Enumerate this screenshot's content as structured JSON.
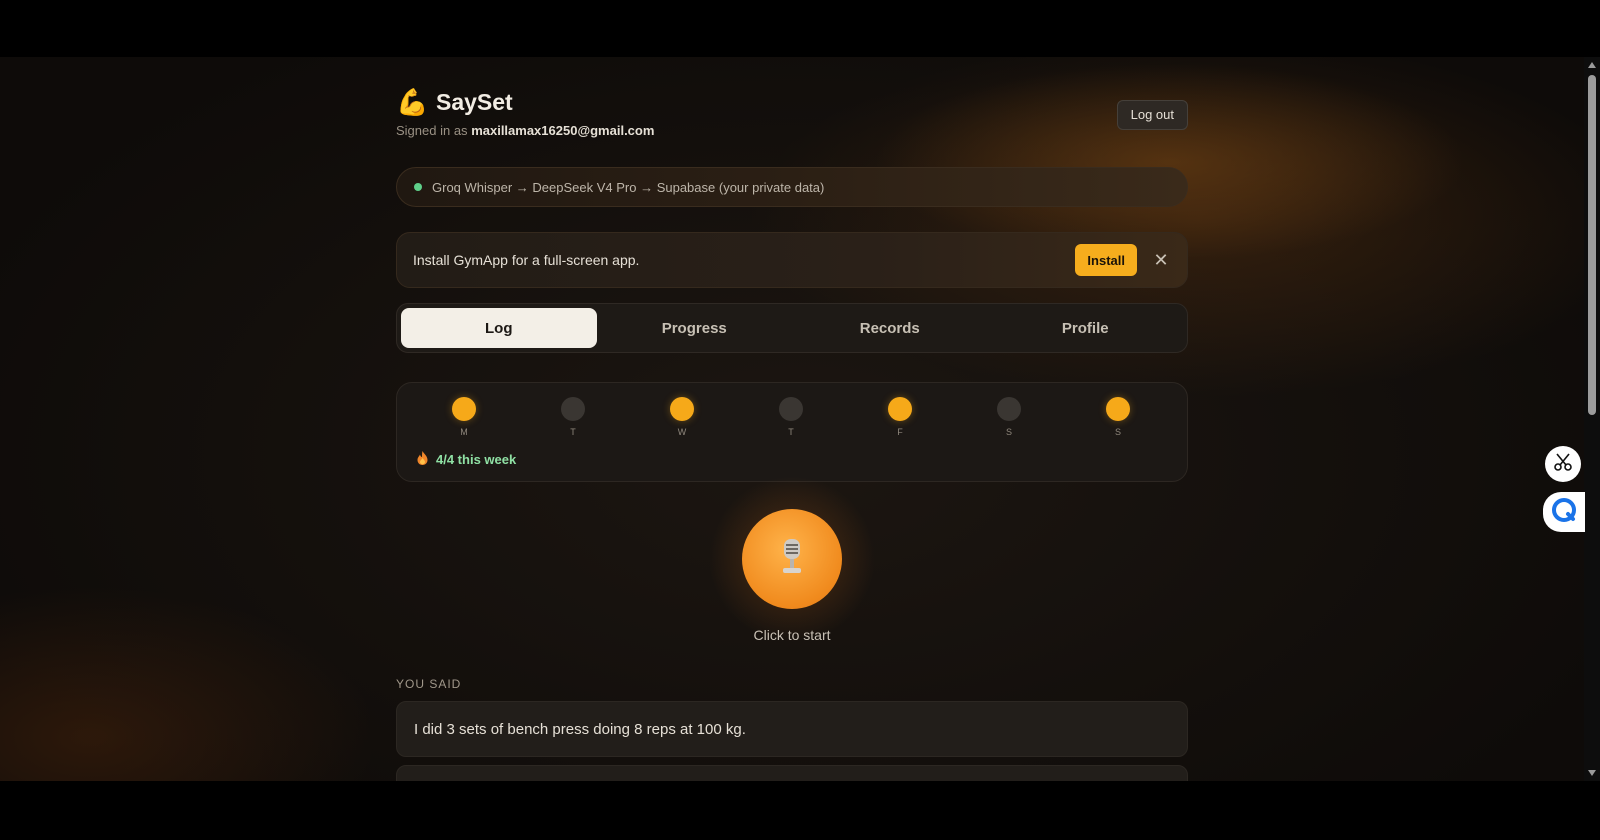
{
  "app": {
    "title": "SaySet",
    "brand_icon": "flexed-biceps-icon",
    "signed_in_prefix": "Signed in as",
    "email": "maxillamax16250@gmail.com",
    "logout_label": "Log out"
  },
  "pipeline": {
    "status_color": "#5fd08a",
    "text": "Groq Whisper → DeepSeek V4 Pro → Supabase (your private data)"
  },
  "install_banner": {
    "text": "Install GymApp for a full-screen app.",
    "install_label": "Install",
    "close_glyph": "✕"
  },
  "tabs": [
    {
      "label": "Log",
      "active": true
    },
    {
      "label": "Progress",
      "active": false
    },
    {
      "label": "Records",
      "active": false
    },
    {
      "label": "Profile",
      "active": false
    }
  ],
  "week": {
    "days": [
      {
        "label": "M",
        "done": true
      },
      {
        "label": "T",
        "done": false
      },
      {
        "label": "W",
        "done": true
      },
      {
        "label": "T",
        "done": false
      },
      {
        "label": "F",
        "done": true
      },
      {
        "label": "S",
        "done": false
      },
      {
        "label": "S",
        "done": true
      }
    ],
    "streak_icon": "flame-icon",
    "streak_text": "4/4 this week"
  },
  "recorder": {
    "icon": "microphone-icon",
    "caption": "Click to start"
  },
  "transcript": {
    "label": "YOU SAID",
    "text": "I did 3 sets of bench press doing 8 reps at 100 kg."
  },
  "colors": {
    "accent": "#f6ad1d",
    "streak": "#8fe0a4",
    "background": "#14110e"
  }
}
